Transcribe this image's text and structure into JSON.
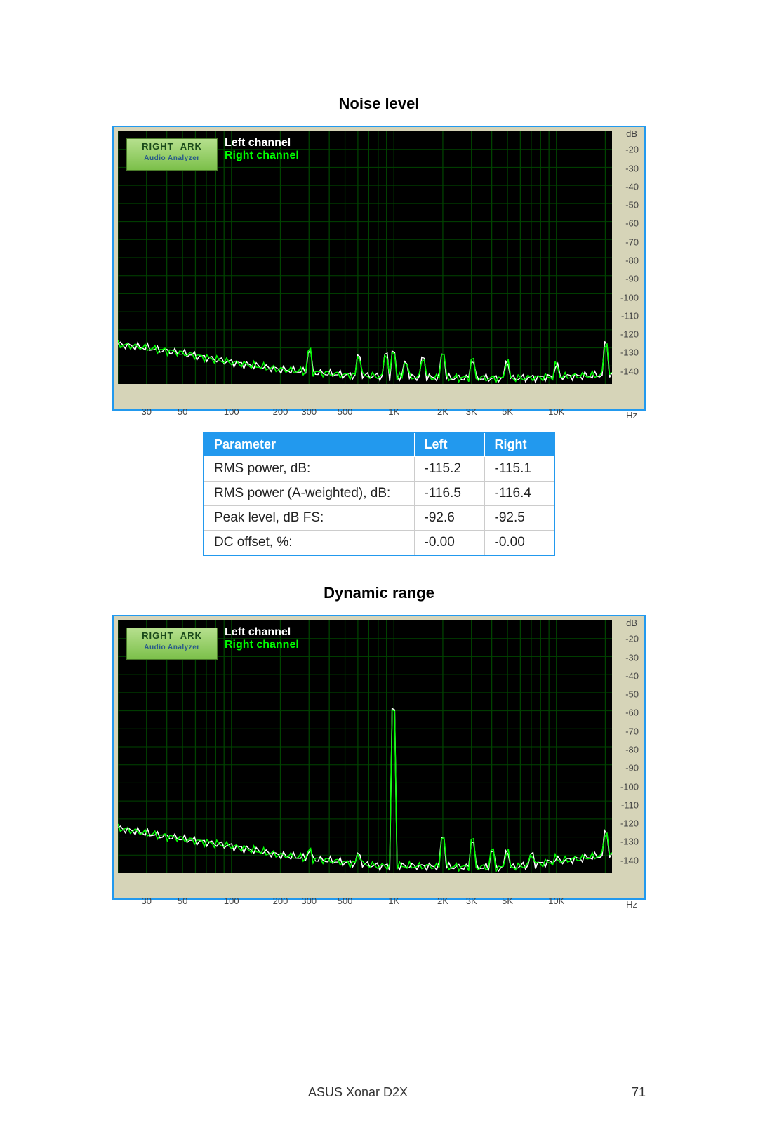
{
  "section1_title": "Noise level",
  "section2_title": "Dynamic range",
  "legend_left": "Left channel",
  "legend_right": "Right channel",
  "logo_line1": "RIGHT",
  "logo_line1b": "ARK",
  "logo_line2": "Audio Analyzer",
  "y_unit": "dB",
  "x_unit": "Hz",
  "table": {
    "headers": {
      "param": "Parameter",
      "left": "Left",
      "right": "Right"
    },
    "rows": [
      {
        "param": "RMS power, dB:",
        "left": "-115.2",
        "right": "-115.1"
      },
      {
        "param": "RMS power (A-weighted), dB:",
        "left": "-116.5",
        "right": "-116.4"
      },
      {
        "param": "Peak level, dB FS:",
        "left": "-92.6",
        "right": "-92.5"
      },
      {
        "param": "DC offset, %:",
        "left": "-0.00",
        "right": "-0.00"
      }
    ]
  },
  "footer_product": "ASUS Xonar D2X",
  "footer_page": "71",
  "chart_data": [
    {
      "type": "line",
      "title": "Noise level",
      "xlabel": "Hz",
      "ylabel": "dB",
      "x_scale": "log",
      "x_ticks": [
        30,
        50,
        100,
        200,
        300,
        500,
        1000,
        2000,
        3000,
        5000,
        10000
      ],
      "x_tick_labels": [
        "30",
        "50",
        "100",
        "200",
        "300",
        "500",
        "1K",
        "2K",
        "3K",
        "5K",
        "10K"
      ],
      "ylim": [
        -150,
        -10
      ],
      "y_ticks": [
        -20,
        -30,
        -40,
        -50,
        -60,
        -70,
        -80,
        -90,
        -100,
        -110,
        -120,
        -130,
        -140
      ],
      "series_names": [
        "Left channel",
        "Right channel"
      ],
      "noise_floor_db": -145,
      "left_curve_approx": [
        {
          "hz": 20,
          "db": -128
        },
        {
          "hz": 30,
          "db": -130
        },
        {
          "hz": 50,
          "db": -133
        },
        {
          "hz": 100,
          "db": -138
        },
        {
          "hz": 200,
          "db": -142
        },
        {
          "hz": 500,
          "db": -145
        },
        {
          "hz": 1000,
          "db": -146
        },
        {
          "hz": 5000,
          "db": -147
        },
        {
          "hz": 20000,
          "db": -145
        }
      ],
      "right_curve_approx": [
        {
          "hz": 20,
          "db": -128
        },
        {
          "hz": 30,
          "db": -130
        },
        {
          "hz": 50,
          "db": -133
        },
        {
          "hz": 100,
          "db": -138
        },
        {
          "hz": 200,
          "db": -142
        },
        {
          "hz": 500,
          "db": -145
        },
        {
          "hz": 1000,
          "db": -146
        },
        {
          "hz": 5000,
          "db": -147
        },
        {
          "hz": 20000,
          "db": -145
        }
      ],
      "spikes_hz_db": [
        {
          "hz": 300,
          "db": -132
        },
        {
          "hz": 600,
          "db": -135
        },
        {
          "hz": 900,
          "db": -134
        },
        {
          "hz": 1000,
          "db": -133
        },
        {
          "hz": 1200,
          "db": -138
        },
        {
          "hz": 1500,
          "db": -136
        },
        {
          "hz": 2000,
          "db": -133
        },
        {
          "hz": 3000,
          "db": -137
        },
        {
          "hz": 5000,
          "db": -138
        },
        {
          "hz": 10000,
          "db": -140
        },
        {
          "hz": 20000,
          "db": -128
        }
      ]
    },
    {
      "type": "line",
      "title": "Dynamic range",
      "xlabel": "Hz",
      "ylabel": "dB",
      "x_scale": "log",
      "x_ticks": [
        30,
        50,
        100,
        200,
        300,
        500,
        1000,
        2000,
        3000,
        5000,
        10000
      ],
      "x_tick_labels": [
        "30",
        "50",
        "100",
        "200",
        "300",
        "500",
        "1K",
        "2K",
        "3K",
        "5K",
        "10K"
      ],
      "ylim": [
        -150,
        -10
      ],
      "y_ticks": [
        -20,
        -30,
        -40,
        -50,
        -60,
        -70,
        -80,
        -90,
        -100,
        -110,
        -120,
        -130,
        -140
      ],
      "series_names": [
        "Left channel",
        "Right channel"
      ],
      "noise_floor_db": -145,
      "tone": {
        "hz": 1000,
        "db": -60
      },
      "left_curve_approx": [
        {
          "hz": 20,
          "db": -125
        },
        {
          "hz": 30,
          "db": -128
        },
        {
          "hz": 50,
          "db": -131
        },
        {
          "hz": 100,
          "db": -135
        },
        {
          "hz": 200,
          "db": -140
        },
        {
          "hz": 500,
          "db": -144
        },
        {
          "hz": 800,
          "db": -146
        },
        {
          "hz": 1200,
          "db": -146
        },
        {
          "hz": 5000,
          "db": -147
        },
        {
          "hz": 20000,
          "db": -140
        }
      ],
      "right_curve_approx": [
        {
          "hz": 20,
          "db": -125
        },
        {
          "hz": 30,
          "db": -128
        },
        {
          "hz": 50,
          "db": -131
        },
        {
          "hz": 100,
          "db": -135
        },
        {
          "hz": 200,
          "db": -140
        },
        {
          "hz": 500,
          "db": -144
        },
        {
          "hz": 800,
          "db": -146
        },
        {
          "hz": 1200,
          "db": -146
        },
        {
          "hz": 5000,
          "db": -147
        },
        {
          "hz": 20000,
          "db": -140
        }
      ],
      "spikes_hz_db": [
        {
          "hz": 300,
          "db": -138
        },
        {
          "hz": 600,
          "db": -140
        },
        {
          "hz": 1000,
          "db": -60
        },
        {
          "hz": 2000,
          "db": -130
        },
        {
          "hz": 3000,
          "db": -132
        },
        {
          "hz": 4000,
          "db": -138
        },
        {
          "hz": 5000,
          "db": -138
        },
        {
          "hz": 7000,
          "db": -140
        },
        {
          "hz": 10000,
          "db": -142
        },
        {
          "hz": 20000,
          "db": -128
        }
      ]
    }
  ]
}
